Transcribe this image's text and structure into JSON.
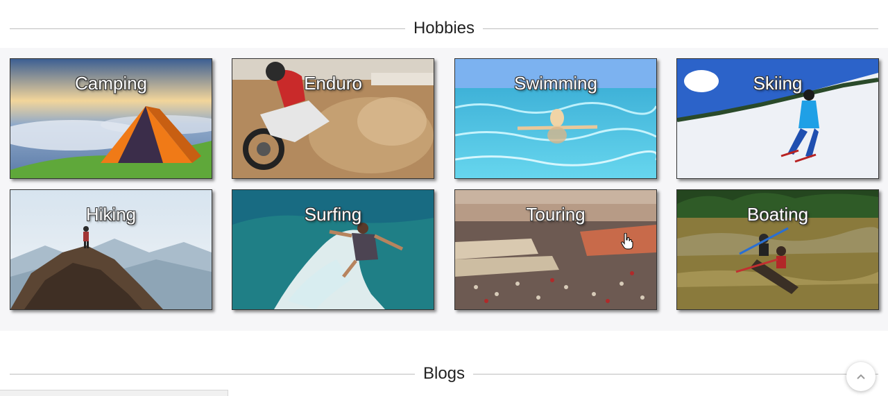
{
  "sections": {
    "hobbies_title": "Hobbies",
    "blogs_title": "Blogs"
  },
  "hobbies": [
    {
      "label": "Camping",
      "image": "tent-on-mountain"
    },
    {
      "label": "Enduro",
      "image": "dirt-bike"
    },
    {
      "label": "Swimming",
      "image": "swimmer-in-pool"
    },
    {
      "label": "Skiing",
      "image": "skier-on-slope"
    },
    {
      "label": "Hiking",
      "image": "hiker-on-peak"
    },
    {
      "label": "Surfing",
      "image": "surfer-on-wave"
    },
    {
      "label": "Touring",
      "image": "market-square"
    },
    {
      "label": "Boating",
      "image": "canoe-in-rapids"
    }
  ],
  "icons": {
    "scroll_top": "chevron-up-icon",
    "cursor": "hand-pointer-icon"
  }
}
